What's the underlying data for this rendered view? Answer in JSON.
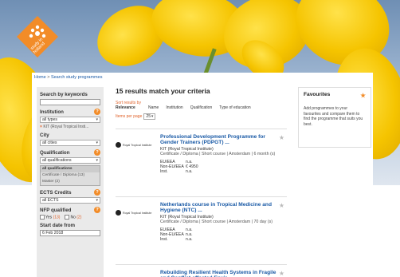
{
  "logo": {
    "text_line1": "study in",
    "text_line2": "holland",
    "color": "#f28c28"
  },
  "breadcrumb": {
    "home": "Home",
    "sep": ">",
    "current": "Search study programmes"
  },
  "sidebar": {
    "keywords_label": "Search by keywords",
    "institution_label": "Institution",
    "institution_select": "all types",
    "institution_chip": "KIT (Royal Tropical Insti...",
    "city_label": "City",
    "city_select": "all cities",
    "qualification_label": "Qualification",
    "qualification_select": "all qualifications",
    "qualification_options": [
      "all qualifications",
      "Certificate / Diploma (13)",
      "Master (2)"
    ],
    "ects_label": "ECTS Credits",
    "ects_select": "all ECTS",
    "nfp_label": "NFP qualified",
    "nfp_yes": "Yes",
    "nfp_yes_count": "(13)",
    "nfp_no": "No",
    "nfp_no_count": "(2)",
    "start_label": "Start date from",
    "start_value": "6 Feb 2018"
  },
  "main": {
    "title": "15 results match your criteria",
    "sort_label": "Sort results by",
    "sort_relevance": "Relevance",
    "sort_name": "Name",
    "sort_institution": "Institution",
    "sort_qualification": "Qualification",
    "sort_type": "Type of education",
    "perpage_label": "Items per page",
    "perpage_value": "25"
  },
  "results": [
    {
      "title": "Professional Development Programme for Gender Trainers (PDPGT) ...",
      "institution": "KIT (Royal Tropical Institute)",
      "meta": "Certificate / Diploma | Short course | Amsterdam | 6 month (s)",
      "logo_text": "Royal Tropical Institute",
      "fees": [
        [
          "EU/EEA",
          "n.a."
        ],
        [
          "Non-EU/EEA",
          "€ 4950"
        ],
        [
          "Inst.",
          "n.a."
        ]
      ]
    },
    {
      "title": "Netherlands course in Tropical Medicine and Hygiene (NTC) ...",
      "institution": "KIT (Royal Tropical Institute)",
      "meta": "Certificate / Diploma | Short course | Amsterdam | 70 day (s)",
      "logo_text": "Royal Tropical Institute",
      "fees": [
        [
          "EU/EEA",
          "n.a."
        ],
        [
          "Non-EU/EEA",
          "n.a."
        ],
        [
          "Inst.",
          "n.a."
        ]
      ]
    },
    {
      "title": "Rebuilding Resilient Health Systems in Fragile and Conflict-affected Envir...",
      "institution": "",
      "meta": "",
      "logo_text": "",
      "fees": []
    }
  ],
  "favourites": {
    "title": "Favourites",
    "text": "Add programmes to your favourites and compare them to find the programme that suits you best."
  },
  "colors": {
    "accent": "#f28c28",
    "link": "#1a5aa6",
    "sidebar_bg": "#eaeaea"
  }
}
